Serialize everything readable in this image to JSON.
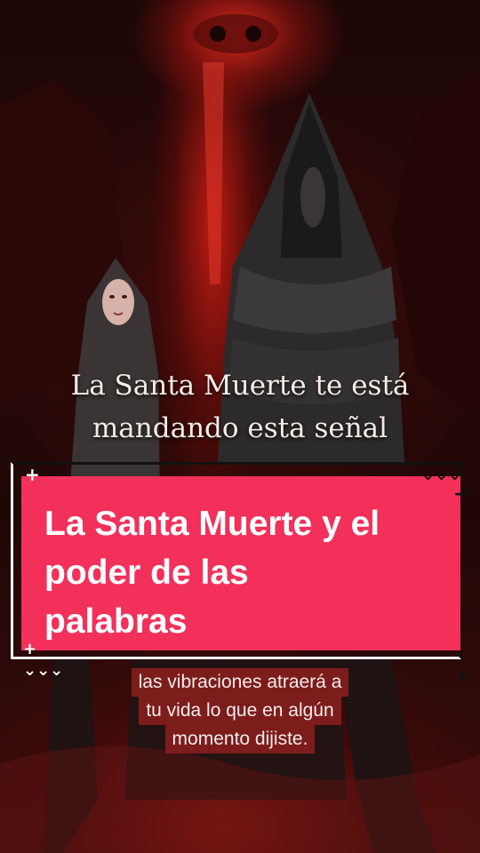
{
  "headline_overlay": {
    "line1": "La Santa Muerte te está",
    "line2": "mandando esta señal"
  },
  "title_card": {
    "line1": "La Santa Muerte y el",
    "line2": "poder de las",
    "line3": "palabras",
    "background_color": "#f2305a"
  },
  "caption": {
    "line1": "las vibraciones atraerá a",
    "line2": "tu vida lo que en algún",
    "line3": "momento dijiste."
  },
  "decorations": {
    "plus": "+",
    "zigzag": "⌄⌄⌄"
  },
  "scene": {
    "image": "hooded-figures-artwork",
    "accent_color": "#d2281e"
  }
}
